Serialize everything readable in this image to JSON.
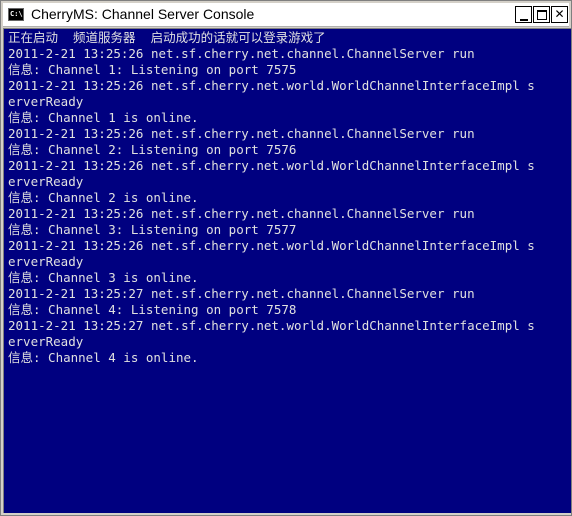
{
  "window": {
    "title": "CherryMS: Channel Server Console",
    "icon_label": "C:\\",
    "icon": "console-icon"
  },
  "console": {
    "background": "#000080",
    "text_color": "#e0e0e0",
    "lines": [
      "正在启动  频道服务器  启动成功的话就可以登录游戏了",
      "2011-2-21 13:25:26 net.sf.cherry.net.channel.ChannelServer run",
      "信息: Channel 1: Listening on port 7575",
      "2011-2-21 13:25:26 net.sf.cherry.net.world.WorldChannelInterfaceImpl s",
      "erverReady",
      "信息: Channel 1 is online.",
      "2011-2-21 13:25:26 net.sf.cherry.net.channel.ChannelServer run",
      "信息: Channel 2: Listening on port 7576",
      "2011-2-21 13:25:26 net.sf.cherry.net.world.WorldChannelInterfaceImpl s",
      "erverReady",
      "信息: Channel 2 is online.",
      "2011-2-21 13:25:26 net.sf.cherry.net.channel.ChannelServer run",
      "信息: Channel 3: Listening on port 7577",
      "2011-2-21 13:25:26 net.sf.cherry.net.world.WorldChannelInterfaceImpl s",
      "erverReady",
      "信息: Channel 3 is online.",
      "2011-2-21 13:25:27 net.sf.cherry.net.channel.ChannelServer run",
      "信息: Channel 4: Listening on port 7578",
      "2011-2-21 13:25:27 net.sf.cherry.net.world.WorldChannelInterfaceImpl s",
      "erverReady",
      "信息: Channel 4 is online."
    ]
  }
}
